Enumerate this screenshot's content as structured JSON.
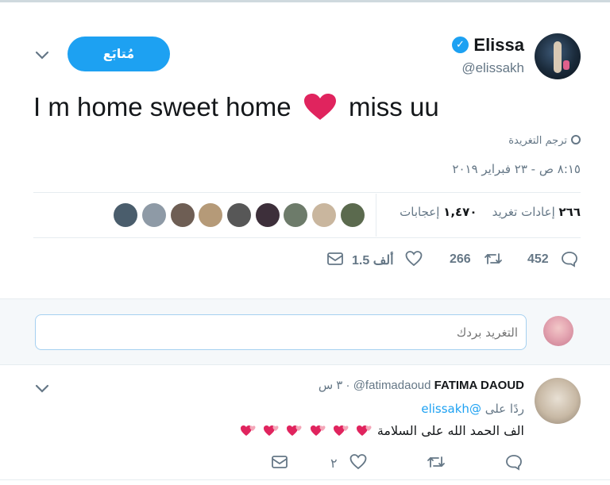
{
  "tweet": {
    "author_name": "Elissa",
    "author_handle": "@elissakh",
    "follow_label": "مُتابَع",
    "text": "I m home sweet home",
    "text_end": "miss uu",
    "translate_label": "ترجم التغريدة",
    "timestamp": "٨:١٥ ص - ٢٣ فبراير ٢٠١٩",
    "retweets_count": "٢٦٦",
    "retweets_label": "إعادات تغريد",
    "likes_count": "١,٤٧٠",
    "likes_label": "إعجابات",
    "reply_count": "452",
    "retweet_action_count": "266",
    "like_action_count": "1.5 ألف"
  },
  "likers": [
    "#4a5d6c",
    "#8e9aa6",
    "#6e5e54",
    "#b59a78",
    "#575757",
    "#3d2f3a",
    "#6d7b6a",
    "#c9b69e",
    "#5b6a4e"
  ],
  "reply_box": {
    "placeholder": "التغريد بردك"
  },
  "reply": {
    "author_name": "FATIMA DAOUD",
    "author_handle": "@fatimadaoud",
    "time": "٣ س",
    "separator": "·",
    "replying_prefix": "ردًا على",
    "replying_to": "@elissakh",
    "text": "الف الحمد الله على السلامة",
    "like_count": "٢"
  },
  "colors": {
    "accent": "#1da1f2",
    "heart": "#e0245e",
    "muted": "#657786"
  }
}
